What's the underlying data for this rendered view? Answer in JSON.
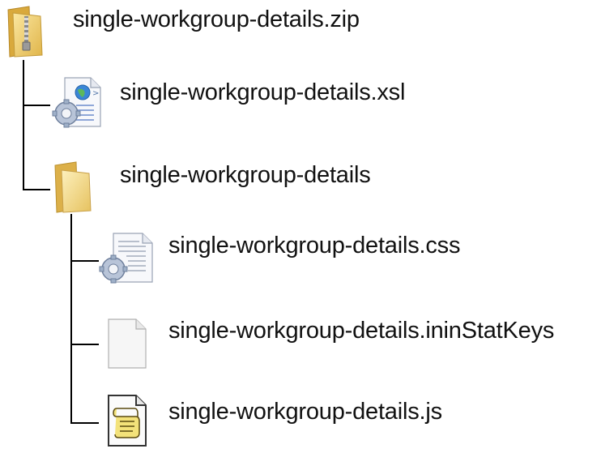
{
  "tree": {
    "root": {
      "label": "single-workgroup-details.zip",
      "icon": "zip-folder-icon"
    },
    "children": [
      {
        "label": "single-workgroup-details.xsl",
        "icon": "xsl-web-file-icon"
      },
      {
        "label": "single-workgroup-details",
        "icon": "folder-icon",
        "children": [
          {
            "label": "single-workgroup-details.css",
            "icon": "css-config-file-icon"
          },
          {
            "label": "single-workgroup-details.ininStatKeys",
            "icon": "blank-file-icon"
          },
          {
            "label": "single-workgroup-details.js",
            "icon": "script-file-icon"
          }
        ]
      }
    ]
  }
}
